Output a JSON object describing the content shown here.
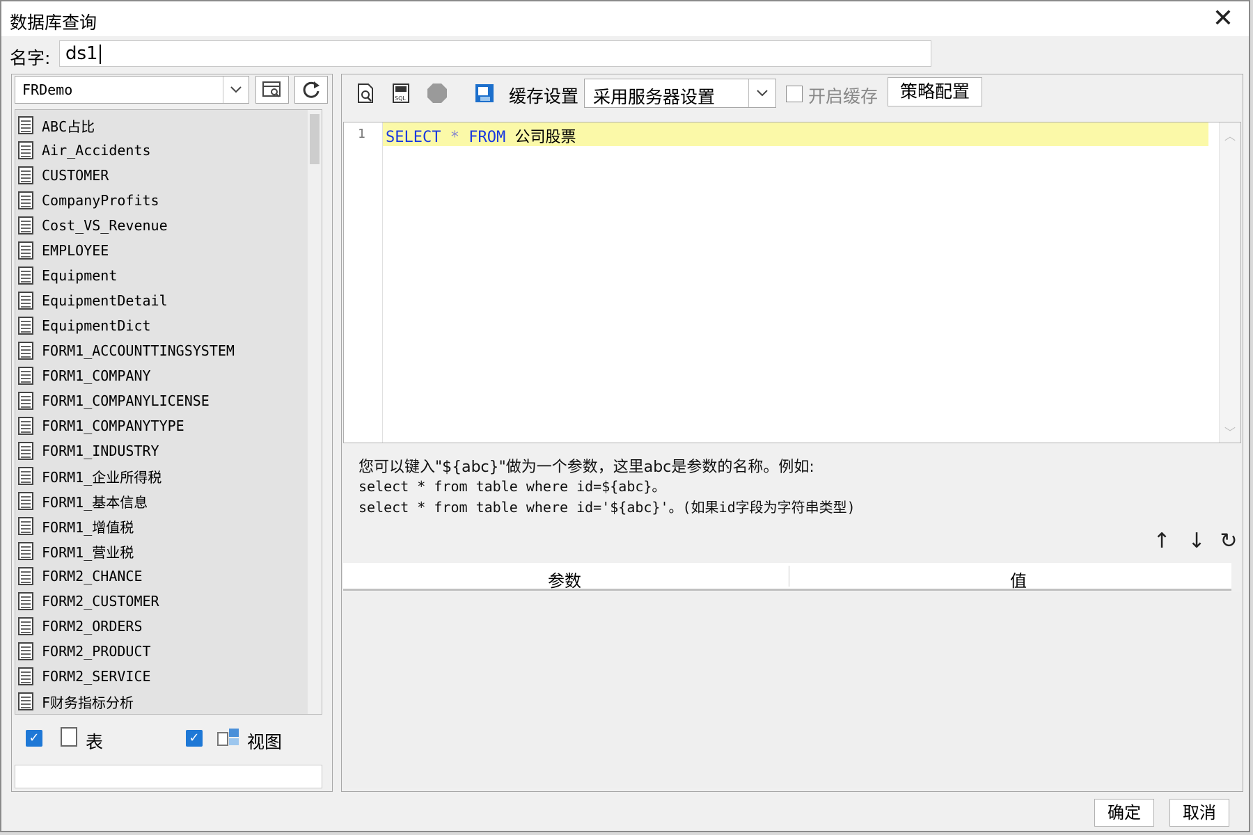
{
  "window": {
    "title": "数据库查询",
    "close_glyph": "✕"
  },
  "name_field": {
    "label": "名字:",
    "value": "ds1"
  },
  "datasource": {
    "selected": "FRDemo"
  },
  "tables": [
    "ABC占比",
    "Air_Accidents",
    "CUSTOMER",
    "CompanyProfits",
    "Cost_VS_Revenue",
    "EMPLOYEE",
    "Equipment",
    "EquipmentDetail",
    "EquipmentDict",
    "FORM1_ACCOUNTTINGSYSTEM",
    "FORM1_COMPANY",
    "FORM1_COMPANYLICENSE",
    "FORM1_COMPANYTYPE",
    "FORM1_INDUSTRY",
    "FORM1_企业所得税",
    "FORM1_基本信息",
    "FORM1_增值税",
    "FORM1_营业税",
    "FORM2_CHANCE",
    "FORM2_CUSTOMER",
    "FORM2_ORDERS",
    "FORM2_PRODUCT",
    "FORM2_SERVICE",
    "F财务指标分析"
  ],
  "filters": {
    "table_label": "表",
    "view_label": "视图",
    "check_glyph": "✓"
  },
  "toolbar": {
    "cache_label": "缓存设置",
    "cache_selected": "采用服务器设置",
    "enable_cache_label": "开启缓存",
    "strategy_button": "策略配置"
  },
  "editor": {
    "line_number": "1",
    "kw_select": "SELECT",
    "star": " * ",
    "kw_from": "FROM",
    "table_name": " 公司股票"
  },
  "hint": {
    "line1": "您可以键入\"${abc}\"做为一个参数，这里abc是参数的名称。例如:",
    "line2": "select * from table where id=${abc}。",
    "line3": "select * from table where id='${abc}'。(如果id字段为字符串类型)"
  },
  "param_grid": {
    "col_param": "参数",
    "col_value": "值"
  },
  "param_buttons": {
    "up": "↑",
    "down": "↓",
    "refresh": "↻"
  },
  "footer": {
    "ok": "确定",
    "cancel": "取消"
  },
  "colors": {
    "keyword": "#1a39e0",
    "highlight_line": "#fbf9a8",
    "checkbox": "#1e78d6"
  }
}
